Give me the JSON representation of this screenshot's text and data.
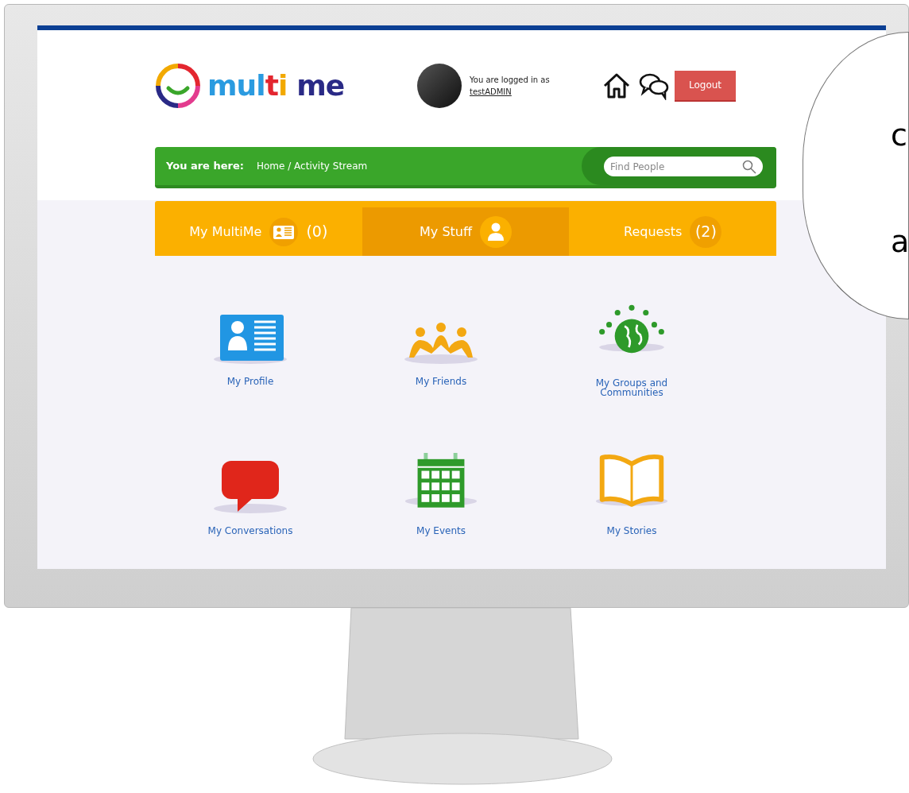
{
  "header": {
    "logo": [
      {
        "text": "mul",
        "color": "#2b9be0"
      },
      {
        "text": "t",
        "color": "#e3262f"
      },
      {
        "text": "i",
        "color": "#f2a900"
      },
      {
        "text": " me",
        "color": "#2a2a86"
      }
    ],
    "login_text": "You are logged in as",
    "username": "testADMIN",
    "logout": "Logout"
  },
  "breadcrumb": {
    "label": "You are here:",
    "path": "Home / Activity Stream",
    "search": {
      "placeholder": "Find People"
    }
  },
  "tabs": [
    {
      "label": "My MultiMe",
      "count": "(0)",
      "selected": false
    },
    {
      "label": "My Stuff",
      "selected": true
    },
    {
      "label": "Requests",
      "count": "(2)",
      "selected": false
    }
  ],
  "tiles": [
    {
      "label": "My Profile"
    },
    {
      "label": "My Friends"
    },
    {
      "label": "My Groups and Communities"
    },
    {
      "label": "My Conversations"
    },
    {
      "label": "My Events"
    },
    {
      "label": "My Stories"
    }
  ],
  "callout": {
    "lines": [
      "c",
      "a"
    ]
  }
}
